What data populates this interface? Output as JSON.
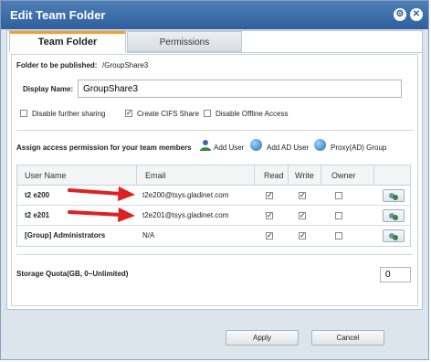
{
  "window": {
    "title": "Edit Team Folder",
    "controls": {
      "settings_icon": "settings-icon",
      "close_icon": "close-icon"
    }
  },
  "tabs": {
    "active": "Team Folder",
    "inactive": "Permissions"
  },
  "form": {
    "folder_label": "Folder to be published:",
    "folder_value": "/GroupShare3",
    "display_name_label": "Display Name:",
    "display_name_value": "GroupShare3",
    "options": [
      {
        "label": "Disable further sharing",
        "checked": false
      },
      {
        "label": "Create CIFS Share",
        "checked": true
      },
      {
        "label": "Disable Offline Access",
        "checked": false
      }
    ]
  },
  "permissions": {
    "assign_label": "Assign access permission for your team members",
    "actions": [
      {
        "label": "Add User",
        "icon": "add-user-icon"
      },
      {
        "label": "Add AD User",
        "icon": "add-ad-user-icon"
      },
      {
        "label": "Proxy(AD) Group",
        "icon": "proxy-ad-group-icon"
      }
    ]
  },
  "table": {
    "headers": {
      "user": "User Name",
      "email": "Email",
      "read": "Read",
      "write": "Write",
      "owner": "Owner"
    },
    "rows": [
      {
        "user": "t2 e200",
        "email": "t2e200@tsys.gladinet.com",
        "read": true,
        "write": true,
        "owner": false
      },
      {
        "user": "t2 e201",
        "email": "t2e201@tsys.gladinet.com",
        "read": true,
        "write": true,
        "owner": false
      },
      {
        "user": "[Group] Administrators",
        "email": "N/A",
        "read": true,
        "write": true,
        "owner": false
      }
    ]
  },
  "quota": {
    "label": "Storage Quota(GB, 0~Unlimited)",
    "value": "0"
  },
  "buttons": {
    "apply": "Apply",
    "cancel": "Cancel"
  },
  "colors": {
    "title_bar": "#3b6aa8",
    "tab_accent": "#f0a030",
    "arrow": "#e02020"
  }
}
